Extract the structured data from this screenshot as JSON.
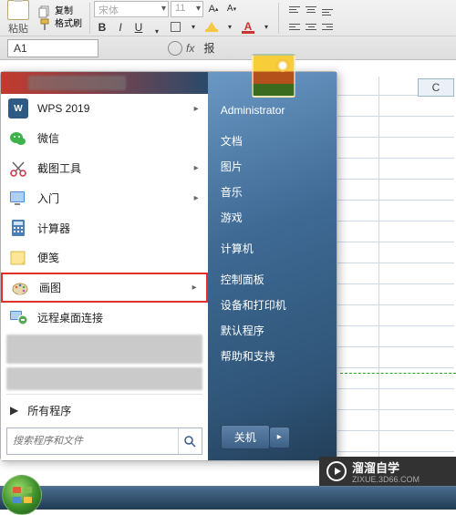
{
  "ribbon": {
    "paste_label": "粘贴",
    "copy_label": "复制",
    "format_painter_label": "格式刷",
    "font_name_placeholder": "宋体",
    "font_size_placeholder": "11",
    "bold": "B",
    "italic": "I",
    "underline": "U"
  },
  "namebar": {
    "cell_ref": "A1",
    "fx_label": "fx",
    "formula_value": "报"
  },
  "sheet": {
    "col_c": "C"
  },
  "startmenu": {
    "items": [
      {
        "label": "WPS 2019",
        "icon": "wps",
        "arrow": true
      },
      {
        "label": "微信",
        "icon": "wechat",
        "arrow": false
      },
      {
        "label": "截图工具",
        "icon": "snip",
        "arrow": true
      },
      {
        "label": "入门",
        "icon": "getting-started",
        "arrow": true
      },
      {
        "label": "计算器",
        "icon": "calc",
        "arrow": false
      },
      {
        "label": "便笺",
        "icon": "sticky",
        "arrow": false
      },
      {
        "label": "画图",
        "icon": "paint",
        "arrow": true
      },
      {
        "label": "远程桌面连接",
        "icon": "rdp",
        "arrow": false
      }
    ],
    "all_programs": "所有程序",
    "search_placeholder": "搜索程序和文件",
    "right": [
      "Administrator",
      "文档",
      "图片",
      "音乐",
      "游戏",
      "计算机",
      "控制面板",
      "设备和打印机",
      "默认程序",
      "帮助和支持"
    ],
    "shutdown": "关机"
  },
  "watermark": {
    "main": "溜溜自学",
    "sub": "ZIXUE.3D66.COM"
  }
}
